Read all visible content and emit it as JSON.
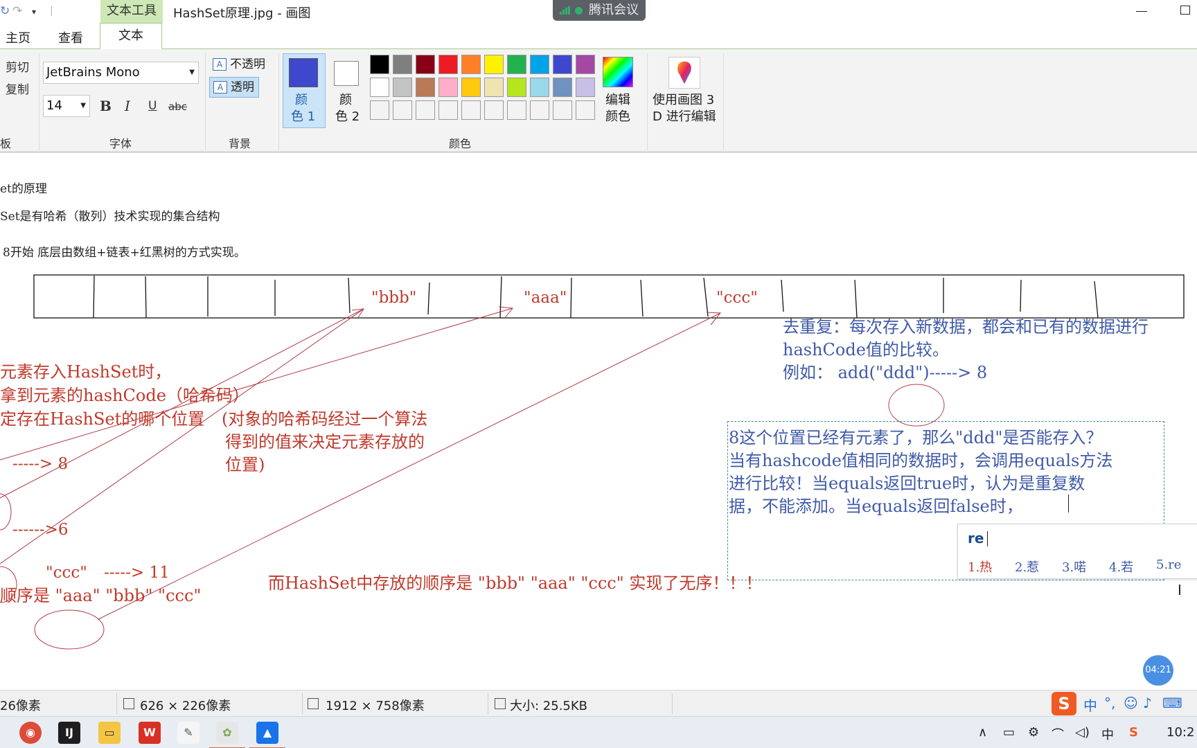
{
  "titlebar": {
    "context_tab": "文本工具",
    "title": "HashSet原理.jpg - 画图",
    "meeting_app": "腾讯会议"
  },
  "tabs": {
    "home": "主页",
    "view": "查看",
    "text": "文本"
  },
  "ribbon": {
    "clipboard": {
      "cut": "剪切",
      "copy": "复制",
      "group_label": "板"
    },
    "font": {
      "family": "JetBrains Mono",
      "size": "14",
      "bold": "B",
      "italic": "I",
      "underline": "U",
      "strike": "abc",
      "group_label": "字体"
    },
    "background": {
      "opaque": "不透明",
      "transparent": "透明",
      "group_label": "背景"
    },
    "colors": {
      "color1_label_line1": "颜",
      "color1_label_line2": "色 1",
      "color2_label_line1": "颜",
      "color2_label_line2": "色 2",
      "group_label": "颜色",
      "edit_line1": "编辑",
      "edit_line2": "颜色",
      "color1": "#3f48cc",
      "color2": "#ffffff",
      "palette_row1": [
        "#000000",
        "#7f7f7f",
        "#880015",
        "#ed1c24",
        "#ff7f27",
        "#fff200",
        "#22b14c",
        "#00a2e8",
        "#3f48cc",
        "#a349a4"
      ],
      "palette_row2": [
        "#ffffff",
        "#c3c3c3",
        "#b97a57",
        "#ffaec9",
        "#ffc90e",
        "#efe4b0",
        "#b5e61d",
        "#99d9ea",
        "#7092be",
        "#c8bfe7"
      ]
    },
    "paint3d": {
      "line1": "使用画图 3",
      "line2": "D 进行编辑"
    }
  },
  "canvas": {
    "line1": "et的原理",
    "line2": "Set是有哈希（散列）技术实现的集合结构",
    "line3": "8开始 底层由数组+链表+红黑树的方式实现。",
    "array_bbb": "\"bbb\"",
    "array_aaa": "\"aaa\"",
    "array_ccc": "\"ccc\"",
    "left_note1": "元素存入HashSet时，",
    "left_note2": "拿到元素的hashCode（哈希码）",
    "left_note3": "定存在HashSet的哪个位置",
    "mid_note1": "(对象的哈希码经过一个算法",
    "mid_note2": "得到的值来决定元素存放的",
    "mid_note3": "位置)",
    "map_8": "-----> 8",
    "map_6": "------>6",
    "map_ccc_label": "\"ccc\"",
    "map_11": "-----> 11",
    "order_bottom": "顺序是 \"aaa\" \"bbb\"  \"ccc\"",
    "order_note": "而HashSet中存放的顺序是 \"bbb\" \"aaa\" \"ccc\" 实现了无序！！！",
    "dedup1": "去重复：每次存入新数据，都会和已有的数据进行",
    "dedup2": "hashCode值的比较。",
    "dedup3": "例如： add(\"ddd\")-----> 8",
    "box1": "8这个位置已经有元素了，那么\"ddd\"是否能存入？",
    "box2": "当有hashcode值相同的数据时，会调用equals方法",
    "box3": "进行比较！当equals返回true时，认为是重复数",
    "box4": "据，不能添加。当equals返回false时，"
  },
  "ime": {
    "composition": "re",
    "candidates": [
      "1.热",
      "2.惹",
      "3.喏",
      "4.若",
      "5.re"
    ]
  },
  "timer": "04:21",
  "statusbar": {
    "pos": "26像素",
    "selection": "626 × 226像素",
    "image_size": "1912 × 758像素",
    "file_size": "大小: 25.5KB"
  },
  "taskbar": {
    "clock": "10:2",
    "ime_lang": "中"
  }
}
